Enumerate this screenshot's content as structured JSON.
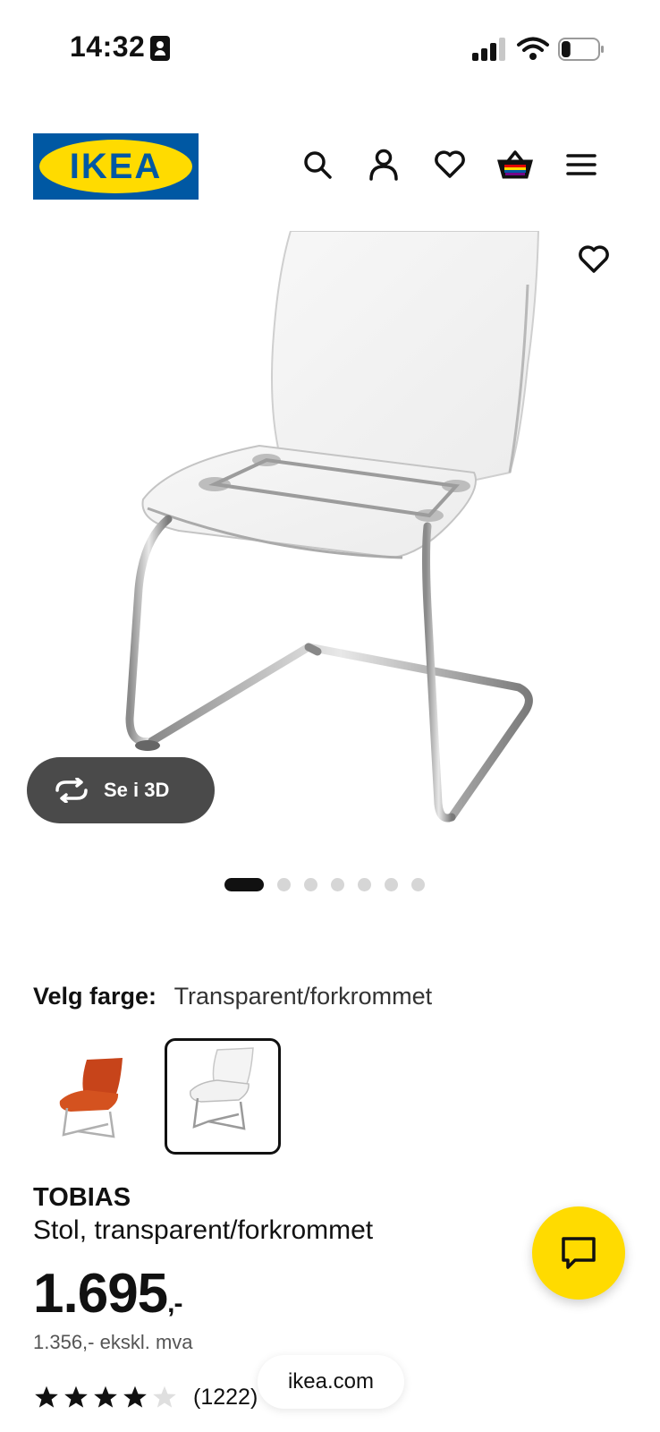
{
  "status_bar": {
    "time": "14:32",
    "battery_level": 0.25
  },
  "header": {
    "logo_text": "IKEA",
    "icons": [
      "search-icon",
      "user-icon",
      "heart-icon",
      "shopping-bag-icon",
      "menu-icon"
    ]
  },
  "gallery": {
    "view_3d_label": "Se i 3D",
    "image_count": 7,
    "active_image": 1
  },
  "color": {
    "title": "Velg farge:",
    "value": "Transparent/forkrommet",
    "options": [
      "Orange",
      "Transparent/forkrommet"
    ],
    "selected_option": 2
  },
  "product": {
    "name": "TOBIAS",
    "description": "Stol, transparent/forkrommet",
    "price": "1.695",
    "price_suffix": ",-",
    "price_ex_vat": "1.356,- ekskl. mva",
    "rating": 4,
    "rating_max": 5,
    "review_count": "(1222)"
  },
  "browser": {
    "url": "ikea.com"
  },
  "colors": {
    "ikea_blue": "#0058a3",
    "ikea_yellow": "#ffdb00",
    "chat_yellow": "#ffdb00",
    "view3d_bg": "#4a4a4a"
  }
}
